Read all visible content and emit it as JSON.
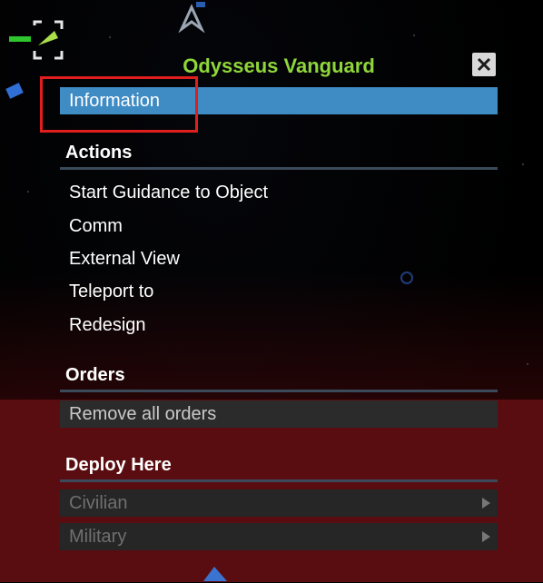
{
  "menu": {
    "title": "Odysseus Vanguard",
    "close_label": "✕",
    "information_label": "Information",
    "sections": {
      "actions": {
        "header": "Actions",
        "items": [
          "Start Guidance to Object",
          "Comm",
          "External View",
          "Teleport to",
          "Redesign"
        ]
      },
      "orders": {
        "header": "Orders",
        "items": [
          "Remove all orders"
        ]
      },
      "deploy": {
        "header": "Deploy Here",
        "items": [
          "Civilian",
          "Military"
        ]
      }
    }
  },
  "colors": {
    "title_green": "#8fd63a",
    "selected_blue": "#3f8bc4",
    "highlight_red": "#e01e1e",
    "red_zone": "#5a0d10"
  },
  "icons": [
    "ship-icon",
    "close-icon",
    "submenu-arrow-icon"
  ]
}
